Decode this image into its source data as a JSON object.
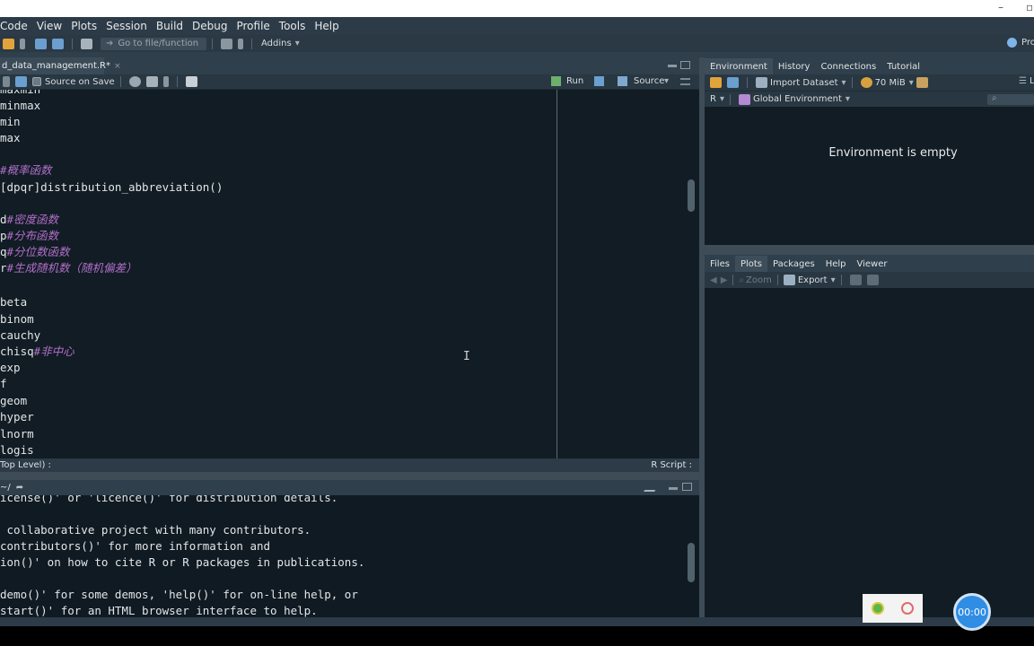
{
  "window": {
    "minimize": "–",
    "maximize": "▫"
  },
  "menu": [
    "Code",
    "View",
    "Plots",
    "Session",
    "Build",
    "Debug",
    "Profile",
    "Tools",
    "Help"
  ],
  "toolbar": {
    "goto_placeholder": "Go to file/function",
    "addins": "Addins",
    "project": "Pro"
  },
  "editor": {
    "tab_name": "d_data_management.R*",
    "tab_close": "×",
    "source_on_save": "Source on Save",
    "run": "Run",
    "source": "Source",
    "lines": [
      {
        "code": "maxmin",
        "comment": ""
      },
      {
        "code": "minmax",
        "comment": ""
      },
      {
        "code": "min",
        "comment": ""
      },
      {
        "code": "max",
        "comment": ""
      },
      {
        "code": "",
        "comment": ""
      },
      {
        "code": "",
        "comment": "#概率函数"
      },
      {
        "code": "[dpqr]distribution_abbreviation()",
        "comment": ""
      },
      {
        "code": "",
        "comment": ""
      },
      {
        "code": "d",
        "comment": "#密度函数"
      },
      {
        "code": "p",
        "comment": "#分布函数"
      },
      {
        "code": "q",
        "comment": "#分位数函数"
      },
      {
        "code": "r",
        "comment": "#生成随机数（随机偏差）"
      },
      {
        "code": "",
        "comment": ""
      },
      {
        "code": "beta",
        "comment": ""
      },
      {
        "code": "binom",
        "comment": ""
      },
      {
        "code": "cauchy",
        "comment": ""
      },
      {
        "code": "chisq",
        "comment": "#非中心"
      },
      {
        "code": "exp",
        "comment": ""
      },
      {
        "code": "f",
        "comment": ""
      },
      {
        "code": "geom",
        "comment": ""
      },
      {
        "code": "hyper",
        "comment": ""
      },
      {
        "code": "lnorm",
        "comment": ""
      },
      {
        "code": "logis",
        "comment": ""
      }
    ],
    "status_scope": "Top Level) :",
    "status_type": "R Script :"
  },
  "console": {
    "path": "~/",
    "lines": [
      "icense()' or 'licence()' for distribution details.",
      "",
      " collaborative project with many contributors.",
      "contributors()' for more information and",
      "ion()' on how to cite R or R packages in publications.",
      "",
      "demo()' for some demos, 'help()' for on-line help, or",
      "start()' for an HTML browser interface to help."
    ]
  },
  "env": {
    "tabs": [
      "Environment",
      "History",
      "Connections",
      "Tutorial"
    ],
    "import": "Import Dataset",
    "memory": "70 MiB",
    "lang": "R",
    "scope": "Global Environment",
    "empty": "Environment is empty",
    "list": "L"
  },
  "files": {
    "tabs": [
      "Files",
      "Plots",
      "Packages",
      "Help",
      "Viewer"
    ],
    "zoom": "Zoom",
    "export": "Export"
  },
  "timer": "00:00"
}
